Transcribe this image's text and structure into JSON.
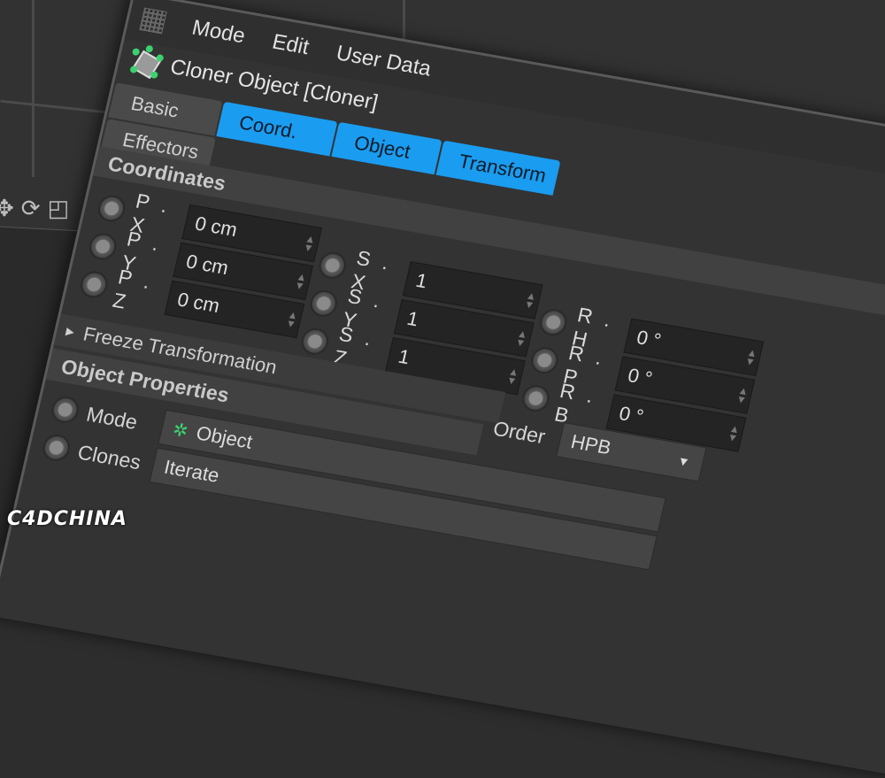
{
  "menu": {
    "items": [
      "Mode",
      "Edit",
      "User Data"
    ]
  },
  "object_header": {
    "title": "Cloner Object [Cloner]",
    "icon": "cloner-icon"
  },
  "tabs": [
    {
      "label": "Basic",
      "active": false
    },
    {
      "label": "Coord.",
      "active": true
    },
    {
      "label": "Object",
      "active": true
    },
    {
      "label": "Transform",
      "active": true
    },
    {
      "label": "Effectors",
      "active": false
    }
  ],
  "coordinates": {
    "title": "Coordinates",
    "position": [
      {
        "label": "P . X",
        "value": "0 cm"
      },
      {
        "label": "P . Y",
        "value": "0 cm"
      },
      {
        "label": "P . Z",
        "value": "0 cm"
      }
    ],
    "scale": [
      {
        "label": "S . X",
        "value": "1"
      },
      {
        "label": "S . Y",
        "value": "1"
      },
      {
        "label": "S . Z",
        "value": "1"
      }
    ],
    "rotation": [
      {
        "label": "R . H",
        "value": "0 °"
      },
      {
        "label": "R . P",
        "value": "0 °"
      },
      {
        "label": "R . B",
        "value": "0 °"
      }
    ],
    "order_label": "Order",
    "order_value": "HPB"
  },
  "freeze": {
    "label": "Freeze Transformation"
  },
  "object_properties": {
    "title": "Object Properties",
    "mode_label": "Mode",
    "mode_value": "Object",
    "clones_label": "Clones",
    "clones_value": "Iterate"
  },
  "watermark": "C4DCHINA",
  "colors": {
    "active_tab": "#1a9cf0",
    "panel_bg": "#333333",
    "cloner_green": "#3bd16f"
  }
}
